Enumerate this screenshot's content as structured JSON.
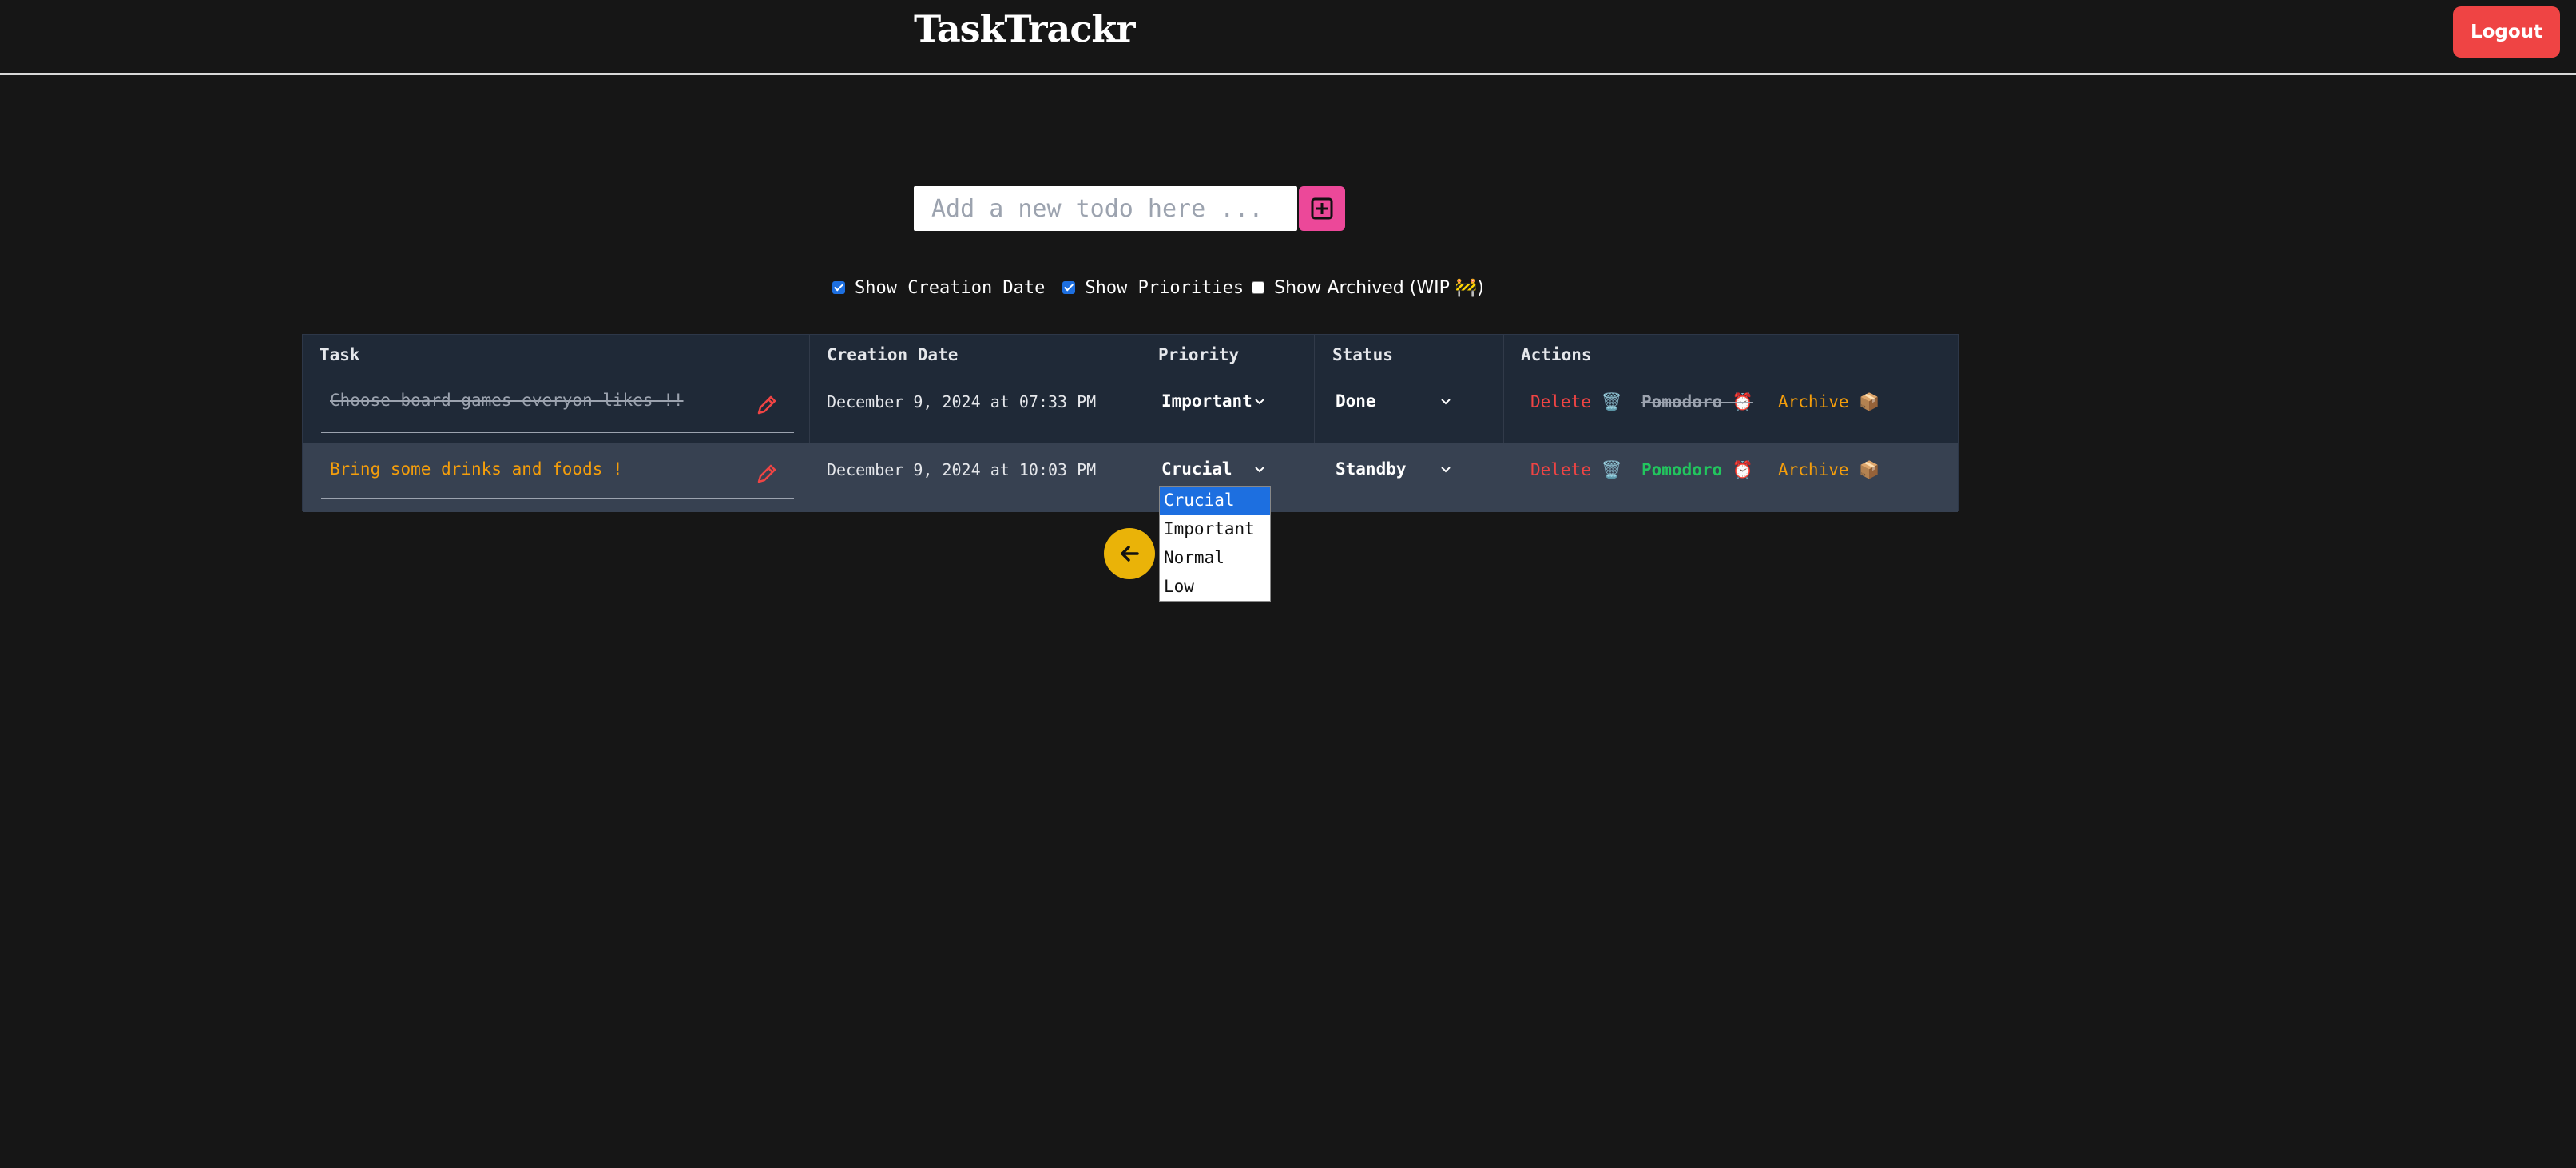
{
  "header": {
    "title": "TaskTrackr",
    "logout_label": "Logout"
  },
  "new_todo": {
    "placeholder": "Add a new todo here ...",
    "add_icon": "plus-square-icon"
  },
  "options": {
    "show_creation_date": {
      "label": "Show Creation Date",
      "checked": true
    },
    "show_priorities": {
      "label": "Show Priorities",
      "checked": true
    },
    "show_archived": {
      "label": "Show Archived (WIP 🚧)",
      "checked": false
    }
  },
  "table": {
    "headers": [
      "Task",
      "Creation Date",
      "Priority",
      "Status",
      "Actions"
    ],
    "rows": [
      {
        "task": "Choose board games everyon likes !!",
        "done": true,
        "date": "December 9, 2024 at 07:33 PM",
        "priority": "Important",
        "status": "Done",
        "delete": "Delete 🗑️",
        "pomodoro": "Pomodoro ⏰",
        "archive": "Archive 📦"
      },
      {
        "task": "Bring some drinks and foods !",
        "done": false,
        "date": "December 9, 2024 at 10:03 PM",
        "priority": "Crucial",
        "status": "Standby",
        "delete": "Delete 🗑️",
        "pomodoro": "Pomodoro ⏰",
        "archive": "Archive 📦"
      }
    ]
  },
  "priority_dropdown": {
    "options": [
      "Crucial",
      "Important",
      "Normal",
      "Low"
    ],
    "selected": "Crucial"
  },
  "colors": {
    "background": "#161616",
    "accent_pink": "#ec4899",
    "danger": "#ef4444",
    "warning": "#f59e0b",
    "success": "#22c55e",
    "back_button": "#eab308"
  },
  "icons": {
    "edit": "pencil-icon",
    "back": "arrow-left-icon",
    "chevron": "chevron-down-icon"
  }
}
